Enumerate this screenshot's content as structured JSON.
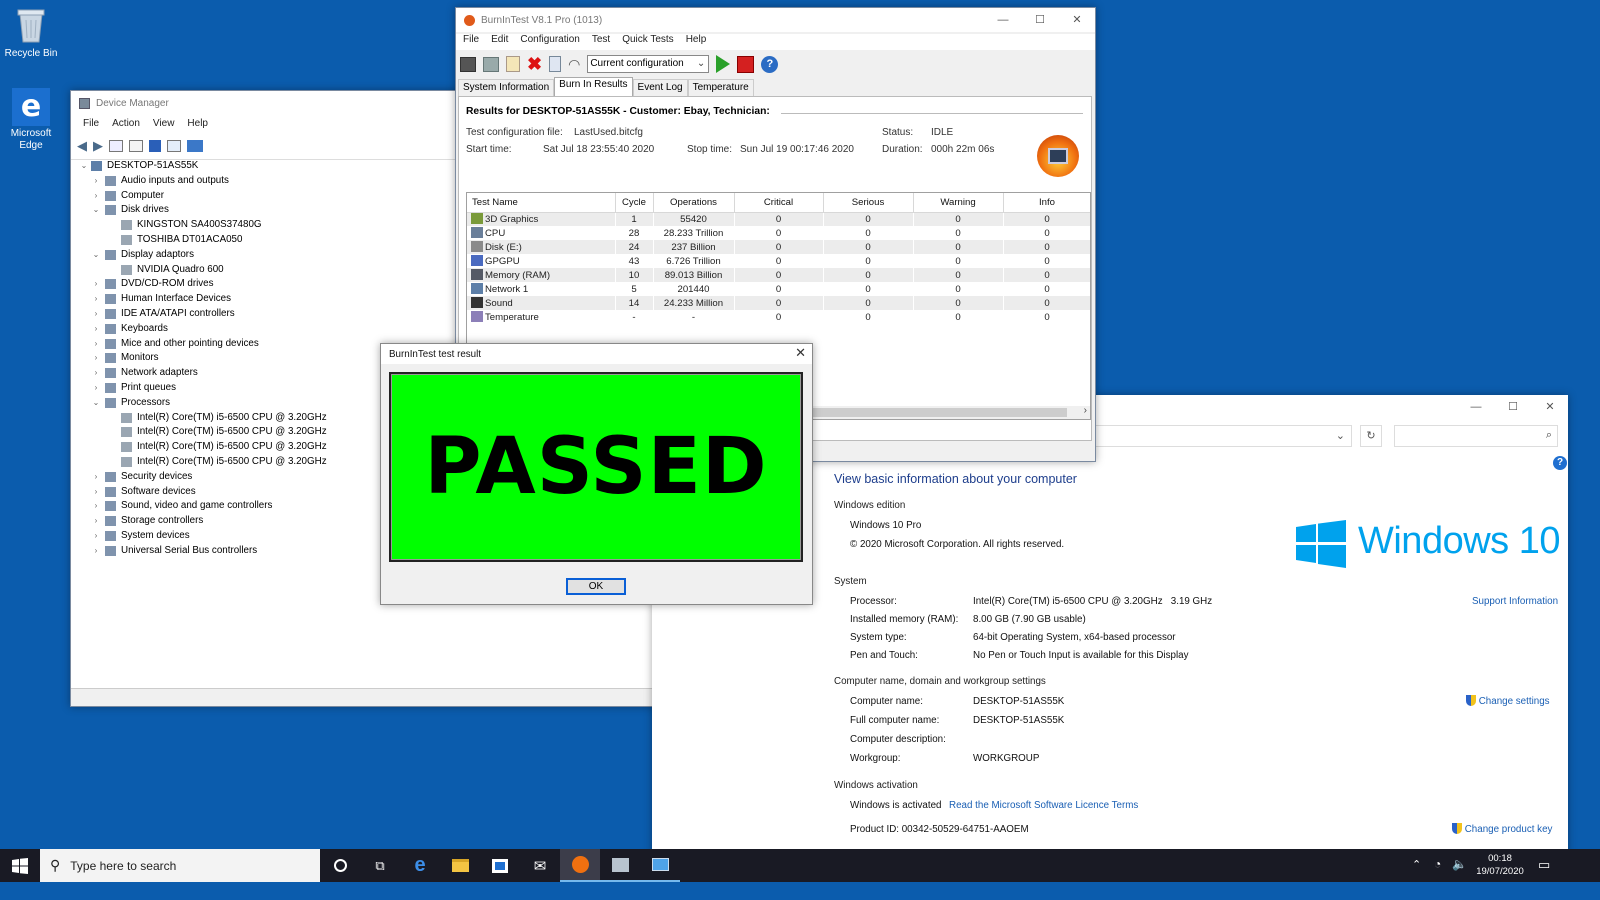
{
  "desktop": {
    "icons": [
      {
        "label": "Recycle Bin",
        "icon": "recycle-bin-icon"
      },
      {
        "label": "Microsoft Edge",
        "icon": "edge-icon"
      }
    ],
    "background_color": "#0b5cad"
  },
  "device_manager": {
    "title": "Device Manager",
    "menu": [
      "File",
      "Action",
      "View",
      "Help"
    ],
    "root": "DESKTOP-51AS55K",
    "tree": [
      {
        "label": "Audio inputs and outputs",
        "level": 1,
        "expanded": false
      },
      {
        "label": "Computer",
        "level": 1,
        "expanded": false
      },
      {
        "label": "Disk drives",
        "level": 1,
        "expanded": true
      },
      {
        "label": "KINGSTON SA400S37480G",
        "level": 2
      },
      {
        "label": "TOSHIBA DT01ACA050",
        "level": 2
      },
      {
        "label": "Display adaptors",
        "level": 1,
        "expanded": true
      },
      {
        "label": "NVIDIA Quadro 600",
        "level": 2
      },
      {
        "label": "DVD/CD-ROM drives",
        "level": 1,
        "expanded": false
      },
      {
        "label": "Human Interface Devices",
        "level": 1,
        "expanded": false
      },
      {
        "label": "IDE ATA/ATAPI controllers",
        "level": 1,
        "expanded": false
      },
      {
        "label": "Keyboards",
        "level": 1,
        "expanded": false
      },
      {
        "label": "Mice and other pointing devices",
        "level": 1,
        "expanded": false
      },
      {
        "label": "Monitors",
        "level": 1,
        "expanded": false
      },
      {
        "label": "Network adapters",
        "level": 1,
        "expanded": false
      },
      {
        "label": "Print queues",
        "level": 1,
        "expanded": false
      },
      {
        "label": "Processors",
        "level": 1,
        "expanded": true
      },
      {
        "label": "Intel(R) Core(TM) i5-6500 CPU @ 3.20GHz",
        "level": 2
      },
      {
        "label": "Intel(R) Core(TM) i5-6500 CPU @ 3.20GHz",
        "level": 2
      },
      {
        "label": "Intel(R) Core(TM) i5-6500 CPU @ 3.20GHz",
        "level": 2
      },
      {
        "label": "Intel(R) Core(TM) i5-6500 CPU @ 3.20GHz",
        "level": 2
      },
      {
        "label": "Security devices",
        "level": 1,
        "expanded": false
      },
      {
        "label": "Software devices",
        "level": 1,
        "expanded": false
      },
      {
        "label": "Sound, video and game controllers",
        "level": 1,
        "expanded": false
      },
      {
        "label": "Storage controllers",
        "level": 1,
        "expanded": false
      },
      {
        "label": "System devices",
        "level": 1,
        "expanded": false
      },
      {
        "label": "Universal Serial Bus controllers",
        "level": 1,
        "expanded": false
      }
    ]
  },
  "burnin": {
    "title": "BurnInTest V8.1 Pro (1013)",
    "menu": [
      "File",
      "Edit",
      "Configuration",
      "Test",
      "Quick Tests",
      "Help"
    ],
    "config_select": "Current configuration",
    "tabs": [
      "System Information",
      "Burn In Results",
      "Event Log",
      "Temperature"
    ],
    "active_tab": "Burn In Results",
    "results_header": "Results for DESKTOP-51AS55K - Customer: Ebay, Technician:",
    "config_file_label": "Test configuration file:",
    "config_file": "LastUsed.bitcfg",
    "start_label": "Start time:",
    "start_time": "Sat Jul 18 23:55:40 2020",
    "stop_label": "Stop time:",
    "stop_time": "Sun Jul 19 00:17:46 2020",
    "status_label": "Status:",
    "status": "IDLE",
    "duration_label": "Duration:",
    "duration": "000h 22m 06s",
    "columns": [
      "Test Name",
      "Cycle",
      "Operations",
      "Critical",
      "Serious",
      "Warning",
      "Info"
    ],
    "rows": [
      {
        "name": "3D Graphics",
        "icon": "3d-graphics-icon",
        "cycle": "1",
        "ops": "55420",
        "critical": "0",
        "serious": "0",
        "warning": "0",
        "info": "0"
      },
      {
        "name": "CPU",
        "icon": "cpu-icon",
        "cycle": "28",
        "ops": "28.233 Trillion",
        "critical": "0",
        "serious": "0",
        "warning": "0",
        "info": "0"
      },
      {
        "name": "Disk (E:)",
        "icon": "disk-icon",
        "cycle": "24",
        "ops": "237 Billion",
        "critical": "0",
        "serious": "0",
        "warning": "0",
        "info": "0"
      },
      {
        "name": "GPGPU",
        "icon": "gpgpu-icon",
        "cycle": "43",
        "ops": "6.726 Trillion",
        "critical": "0",
        "serious": "0",
        "warning": "0",
        "info": "0"
      },
      {
        "name": "Memory (RAM)",
        "icon": "memory-icon",
        "cycle": "10",
        "ops": "89.013 Billion",
        "critical": "0",
        "serious": "0",
        "warning": "0",
        "info": "0"
      },
      {
        "name": "Network 1",
        "icon": "network-icon",
        "cycle": "5",
        "ops": "201440",
        "critical": "0",
        "serious": "0",
        "warning": "0",
        "info": "0"
      },
      {
        "name": "Sound",
        "icon": "sound-icon",
        "cycle": "14",
        "ops": "24.233 Million",
        "critical": "0",
        "serious": "0",
        "warning": "0",
        "info": "0"
      },
      {
        "name": "Temperature",
        "icon": "temperature-icon",
        "cycle": "-",
        "ops": "-",
        "critical": "0",
        "serious": "0",
        "warning": "0",
        "info": "0"
      }
    ]
  },
  "result_dialog": {
    "title": "BurnInTest test result",
    "result": "PASSED",
    "ok_label": "OK",
    "result_color": "#00ff00"
  },
  "system": {
    "heading": "View basic information about your computer",
    "edition_heading": "Windows edition",
    "edition": "Windows 10 Pro",
    "copyright": "© 2020 Microsoft Corporation. All rights reserved.",
    "logo_text": "Windows 10",
    "system_heading": "System",
    "processor_label": "Processor:",
    "processor": "Intel(R) Core(TM) i5-6500 CPU @ 3.20GHz   3.19 GHz",
    "memory_label": "Installed memory (RAM):",
    "memory": "8.00 GB (7.90 GB usable)",
    "systype_label": "System type:",
    "systype": "64-bit Operating System, x64-based processor",
    "pen_label": "Pen and Touch:",
    "pen": "No Pen or Touch Input is available for this Display",
    "support_link": "Support Information",
    "name_heading": "Computer name, domain and workgroup settings",
    "cname_label": "Computer name:",
    "cname": "DESKTOP-51AS55K",
    "fullname_label": "Full computer name:",
    "fullname": "DESKTOP-51AS55K",
    "desc_label": "Computer description:",
    "workgroup_label": "Workgroup:",
    "workgroup": "WORKGROUP",
    "change_settings": "Change settings",
    "activation_heading": "Windows activation",
    "activated": "Windows is activated",
    "licence_link": "Read the Microsoft Software Licence Terms",
    "product_id": "Product ID: 00342-50529-64751-AAOEM",
    "change_key": "Change product key",
    "accent": "#00a2ed"
  },
  "taskbar": {
    "search_placeholder": "Type here to search",
    "time": "00:18",
    "date": "19/07/2020"
  }
}
